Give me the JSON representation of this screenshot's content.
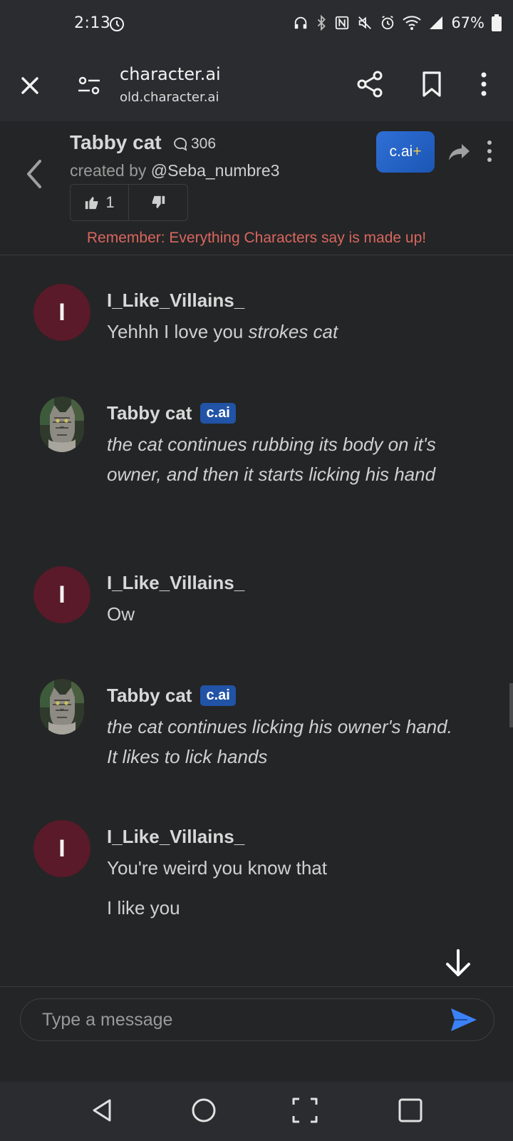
{
  "status_bar": {
    "time": "2:13",
    "battery": "67%"
  },
  "browser": {
    "title": "character.ai",
    "url": "old.character.ai"
  },
  "character": {
    "name": "Tabby cat",
    "chat_count": "306",
    "created_by_prefix": "created by ",
    "creator": "@Seba_numbre3",
    "likes": "1",
    "plus_label": "c.ai",
    "plus_mark": "+",
    "disclaimer": "Remember: Everything Characters say is made up!"
  },
  "messages": [
    {
      "author": "I_Like_Villains_",
      "initial": "I",
      "text": "Yehhh I love you ",
      "italic": "strokes cat"
    },
    {
      "author": "Tabby cat",
      "badge": "c.ai",
      "italic": "the cat continues rubbing its body on it's owner, and then it starts licking his hand"
    },
    {
      "author": "I_Like_Villains_",
      "initial": "I",
      "text": "Ow"
    },
    {
      "author": "Tabby cat",
      "badge": "c.ai",
      "italic": "the cat continues licking his owner's hand. It likes to lick hands"
    },
    {
      "author": "I_Like_Villains_",
      "initial": "I",
      "text": "You're weird you know that",
      "text2": "I like you"
    }
  ],
  "composer": {
    "placeholder": "Type a message"
  },
  "colors": {
    "background": "#242526",
    "user_avatar": "#5a1a2a",
    "badge": "#2153a6",
    "disclaimer": "#d9665f",
    "send": "#3b82f6"
  },
  "icons": {
    "close": "close-icon",
    "tune": "tune-icon",
    "share": "share-icon",
    "bookmark": "bookmark-icon",
    "more": "more-vert-icon",
    "back": "chevron-left-icon",
    "forward": "forward-icon",
    "thumbs_up": "thumbs-up-icon",
    "thumbs_down": "thumbs-down-icon",
    "scroll_down": "arrow-down-icon",
    "send": "send-icon"
  }
}
